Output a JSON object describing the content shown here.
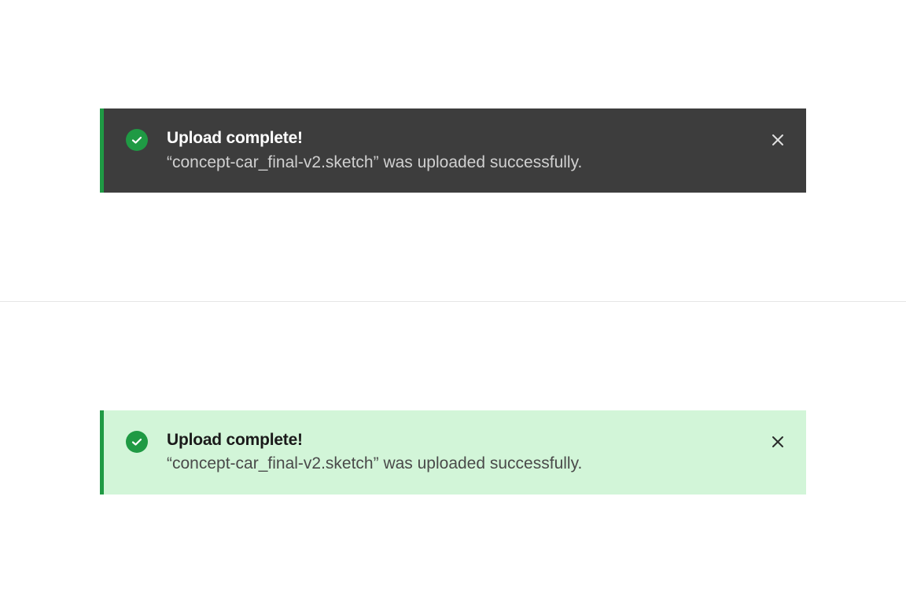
{
  "toasts": [
    {
      "variant": "dark",
      "title": "Upload complete!",
      "message": "“concept-car_final-v2.sketch” was uploaded successfully."
    },
    {
      "variant": "light",
      "title": "Upload complete!",
      "message": "“concept-car_final-v2.sketch” was uploaded successfully."
    }
  ],
  "colors": {
    "accent_green": "#1f9a44",
    "dark_bg": "#3d3d3d",
    "light_bg": "#d2f5d8"
  }
}
